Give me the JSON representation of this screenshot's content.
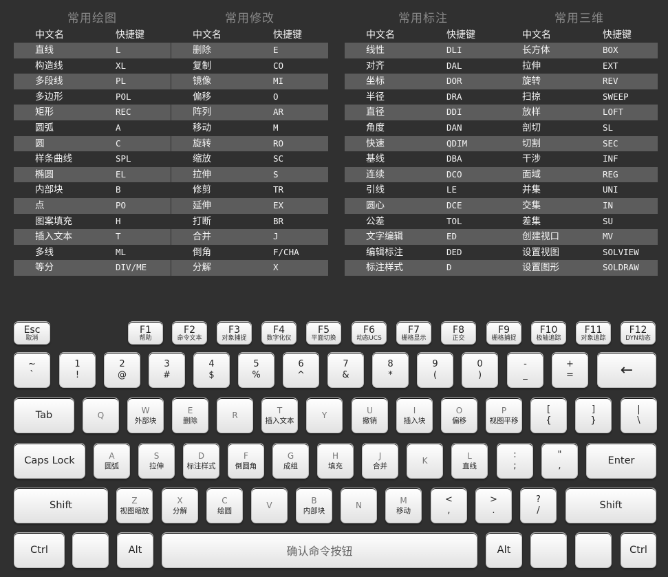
{
  "columns": [
    {
      "title": "常用绘图",
      "header_name": "中文名",
      "header_key": "快捷键",
      "rows": [
        {
          "name": "直线",
          "key": "L"
        },
        {
          "name": "构造线",
          "key": "XL"
        },
        {
          "name": "多段线",
          "key": "PL"
        },
        {
          "name": "多边形",
          "key": "POL"
        },
        {
          "name": "矩形",
          "key": "REC"
        },
        {
          "name": "圆弧",
          "key": "A"
        },
        {
          "name": "圆",
          "key": "C"
        },
        {
          "name": "样条曲线",
          "key": "SPL"
        },
        {
          "name": "椭圆",
          "key": "EL"
        },
        {
          "name": "内部块",
          "key": "B"
        },
        {
          "name": "点",
          "key": "PO"
        },
        {
          "name": "图案填充",
          "key": "H"
        },
        {
          "name": "插入文本",
          "key": "T"
        },
        {
          "name": "多线",
          "key": "ML"
        },
        {
          "name": "等分",
          "key": "DIV/ME"
        }
      ]
    },
    {
      "title": "常用修改",
      "header_name": "中文名",
      "header_key": "快捷键",
      "rows": [
        {
          "name": "删除",
          "key": "E"
        },
        {
          "name": "复制",
          "key": "CO"
        },
        {
          "name": "镜像",
          "key": "MI"
        },
        {
          "name": "偏移",
          "key": "O"
        },
        {
          "name": "阵列",
          "key": "AR"
        },
        {
          "name": "移动",
          "key": "M"
        },
        {
          "name": "旋转",
          "key": "RO"
        },
        {
          "name": "缩放",
          "key": "SC"
        },
        {
          "name": "拉伸",
          "key": "S"
        },
        {
          "name": "修剪",
          "key": "TR"
        },
        {
          "name": "延伸",
          "key": "EX"
        },
        {
          "name": "打断",
          "key": "BR"
        },
        {
          "name": "合并",
          "key": "J"
        },
        {
          "name": "倒角",
          "key": "F/CHA"
        },
        {
          "name": "分解",
          "key": "X"
        }
      ]
    },
    {
      "title": "常用标注",
      "header_name": "中文名",
      "header_key": "快捷键",
      "rows": [
        {
          "name": "线性",
          "key": "DLI"
        },
        {
          "name": "对齐",
          "key": "DAL"
        },
        {
          "name": "坐标",
          "key": "DOR"
        },
        {
          "name": "半径",
          "key": "DRA"
        },
        {
          "name": "直径",
          "key": "DDI"
        },
        {
          "name": "角度",
          "key": "DAN"
        },
        {
          "name": "快速",
          "key": "QDIM"
        },
        {
          "name": "基线",
          "key": "DBA"
        },
        {
          "name": "连续",
          "key": "DCO"
        },
        {
          "name": "引线",
          "key": "LE"
        },
        {
          "name": "圆心",
          "key": "DCE"
        },
        {
          "name": "公差",
          "key": "TOL"
        },
        {
          "name": "文字编辑",
          "key": "ED"
        },
        {
          "name": "编辑标注",
          "key": "DED"
        },
        {
          "name": "标注样式",
          "key": "D"
        }
      ]
    },
    {
      "title": "常用三维",
      "header_name": "中文名",
      "header_key": "快捷键",
      "rows": [
        {
          "name": "长方体",
          "key": "BOX"
        },
        {
          "name": "拉伸",
          "key": "EXT"
        },
        {
          "name": "旋转",
          "key": "REV"
        },
        {
          "name": "扫掠",
          "key": "SWEEP"
        },
        {
          "name": "放样",
          "key": "LOFT"
        },
        {
          "name": "剖切",
          "key": "SL"
        },
        {
          "name": "切割",
          "key": "SEC"
        },
        {
          "name": "干涉",
          "key": "INF"
        },
        {
          "name": "面域",
          "key": "REG"
        },
        {
          "name": "并集",
          "key": "UNI"
        },
        {
          "name": "交集",
          "key": "IN"
        },
        {
          "name": "差集",
          "key": "SU"
        },
        {
          "name": "创建视口",
          "key": "MV"
        },
        {
          "name": "设置视图",
          "key": "SOLVIEW"
        },
        {
          "name": "设置图形",
          "key": "SOLDRAW"
        }
      ]
    }
  ],
  "keyboard": {
    "esc": {
      "main": "Esc",
      "sub": "取消"
    },
    "fkeys": [
      {
        "main": "F1",
        "sub": "帮助"
      },
      {
        "main": "F2",
        "sub": "命令文本"
      },
      {
        "main": "F3",
        "sub": "对象捕捉"
      },
      {
        "main": "F4",
        "sub": "数字化仪"
      },
      {
        "main": "F5",
        "sub": "平面切换"
      },
      {
        "main": "F6",
        "sub": "动态UCS"
      },
      {
        "main": "F7",
        "sub": "栅格显示"
      },
      {
        "main": "F8",
        "sub": "正交"
      },
      {
        "main": "F9",
        "sub": "栅格捕捉"
      },
      {
        "main": "F10",
        "sub": "极轴追踪"
      },
      {
        "main": "F11",
        "sub": "对象追踪"
      },
      {
        "main": "F12",
        "sub": "DYN动态"
      }
    ],
    "number_row": [
      {
        "main": "~",
        "sub": "`"
      },
      {
        "main": "1",
        "sub": "!"
      },
      {
        "main": "2",
        "sub": "@"
      },
      {
        "main": "3",
        "sub": "#"
      },
      {
        "main": "4",
        "sub": "$"
      },
      {
        "main": "5",
        "sub": "%"
      },
      {
        "main": "6",
        "sub": "^"
      },
      {
        "main": "7",
        "sub": "&"
      },
      {
        "main": "8",
        "sub": "*"
      },
      {
        "main": "9",
        "sub": "("
      },
      {
        "main": "0",
        "sub": ")"
      },
      {
        "main": "-",
        "sub": "_"
      },
      {
        "main": "+",
        "sub": "="
      }
    ],
    "backspace": "←",
    "tab": "Tab",
    "qwerty_row": [
      {
        "main": "Q",
        "sub": ""
      },
      {
        "main": "W",
        "sub": "外部块"
      },
      {
        "main": "E",
        "sub": "删除"
      },
      {
        "main": "R",
        "sub": ""
      },
      {
        "main": "T",
        "sub": "插入文本"
      },
      {
        "main": "Y",
        "sub": ""
      },
      {
        "main": "U",
        "sub": "撤销"
      },
      {
        "main": "I",
        "sub": "插入块"
      },
      {
        "main": "O",
        "sub": "偏移"
      },
      {
        "main": "P",
        "sub": "视图平移"
      },
      {
        "main": "[",
        "sub": "{"
      },
      {
        "main": "]",
        "sub": "}"
      },
      {
        "main": "|",
        "sub": "\\"
      }
    ],
    "caps": "Caps Lock",
    "home_row": [
      {
        "main": "A",
        "sub": "圆弧"
      },
      {
        "main": "S",
        "sub": "拉伸"
      },
      {
        "main": "D",
        "sub": "标注样式"
      },
      {
        "main": "F",
        "sub": "倒圆角"
      },
      {
        "main": "G",
        "sub": "成组"
      },
      {
        "main": "H",
        "sub": "填充"
      },
      {
        "main": "J",
        "sub": "合并"
      },
      {
        "main": "K",
        "sub": ""
      },
      {
        "main": "L",
        "sub": "直线"
      },
      {
        "main": ":",
        "sub": ";"
      },
      {
        "main": "\"",
        "sub": ","
      }
    ],
    "enter": "Enter",
    "shift": "Shift",
    "bottom_row": [
      {
        "main": "Z",
        "sub": "视图缩放"
      },
      {
        "main": "X",
        "sub": "分解"
      },
      {
        "main": "C",
        "sub": "绘圆"
      },
      {
        "main": "V",
        "sub": ""
      },
      {
        "main": "B",
        "sub": "内部块"
      },
      {
        "main": "N",
        "sub": ""
      },
      {
        "main": "M",
        "sub": "移动"
      },
      {
        "main": "<",
        "sub": ","
      },
      {
        "main": ">",
        "sub": "."
      },
      {
        "main": "?",
        "sub": "/"
      }
    ],
    "ctrl": "Ctrl",
    "alt": "Alt",
    "space": "确认命令按钮",
    "blank": ""
  }
}
